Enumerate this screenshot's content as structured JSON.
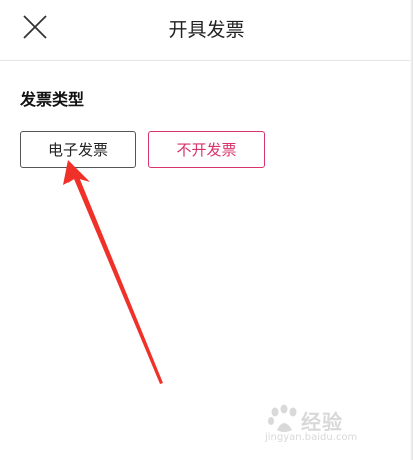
{
  "header": {
    "title": "开具发票"
  },
  "section": {
    "title": "发票类型"
  },
  "options": {
    "electronic": "电子发票",
    "none": "不开发票"
  },
  "watermark": {
    "brand": "经验",
    "url": "jingyan.baidu.com"
  },
  "colors": {
    "accent": "#d8336a",
    "arrow": "#f0312a"
  }
}
